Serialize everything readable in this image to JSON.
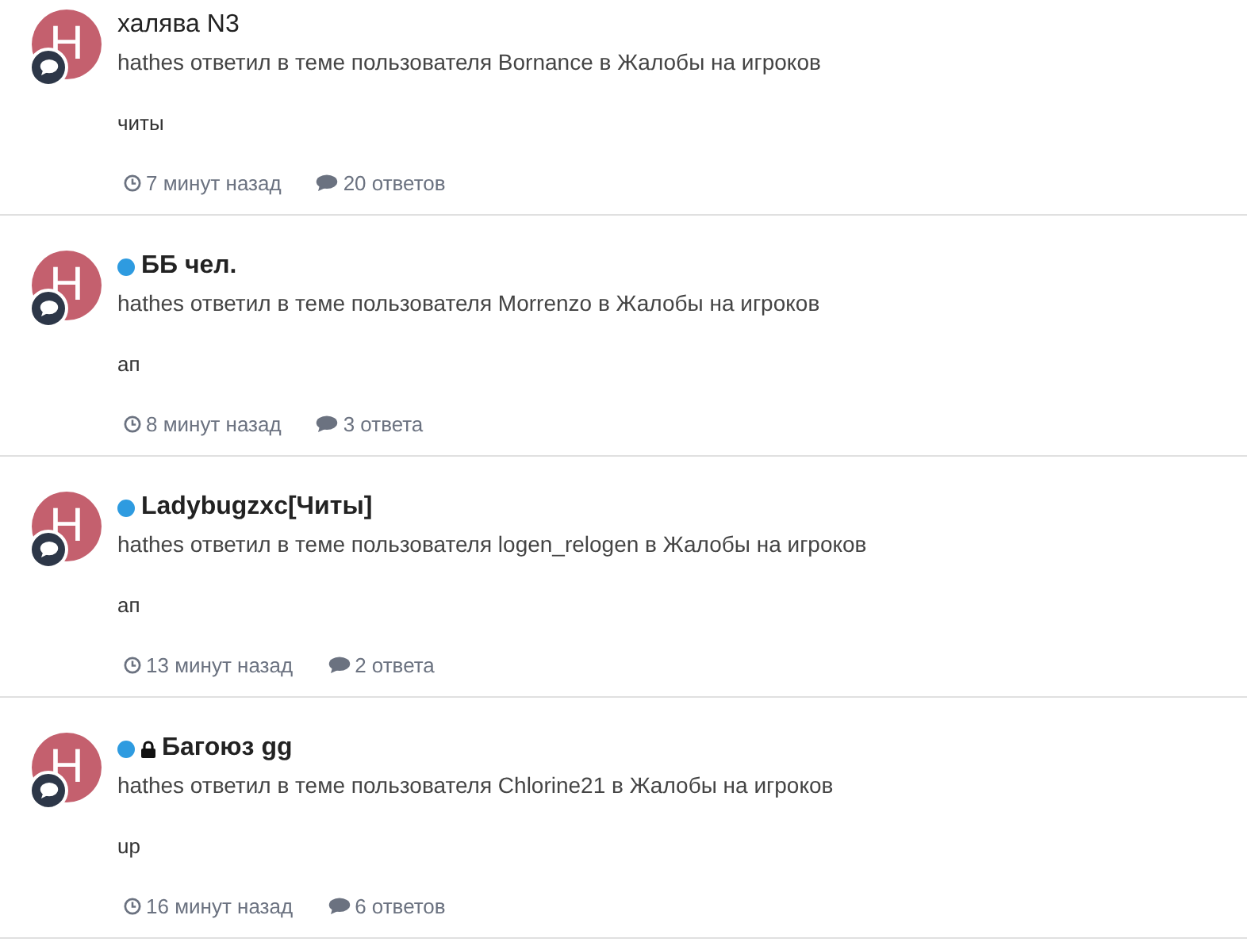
{
  "activity": [
    {
      "avatar_letter": "H",
      "title": "халява N3",
      "unread": false,
      "locked": false,
      "summary": "hathes ответил в теме пользователя Bornance в Жалобы на игроков",
      "snippet": "читы",
      "time": "7 минут назад",
      "replies": "20 ответов"
    },
    {
      "avatar_letter": "H",
      "title": "ББ чел.",
      "unread": true,
      "locked": false,
      "summary": "hathes ответил в теме пользователя Morrenzo в Жалобы на игроков",
      "snippet": "ап",
      "time": "8 минут назад",
      "replies": "3 ответа"
    },
    {
      "avatar_letter": "H",
      "title": "Ladybugzxc[Читы]",
      "unread": true,
      "locked": false,
      "summary": "hathes ответил в теме пользователя logen_relogen в Жалобы на игроков",
      "snippet": "ап",
      "time": "13 минут назад",
      "replies": "2 ответа"
    },
    {
      "avatar_letter": "H",
      "title": "Багоюз gg",
      "unread": true,
      "locked": true,
      "summary": "hathes ответил в теме пользователя Chlorine21 в Жалобы на игроков",
      "snippet": "up",
      "time": "16 минут назад",
      "replies": "6 ответов"
    }
  ]
}
